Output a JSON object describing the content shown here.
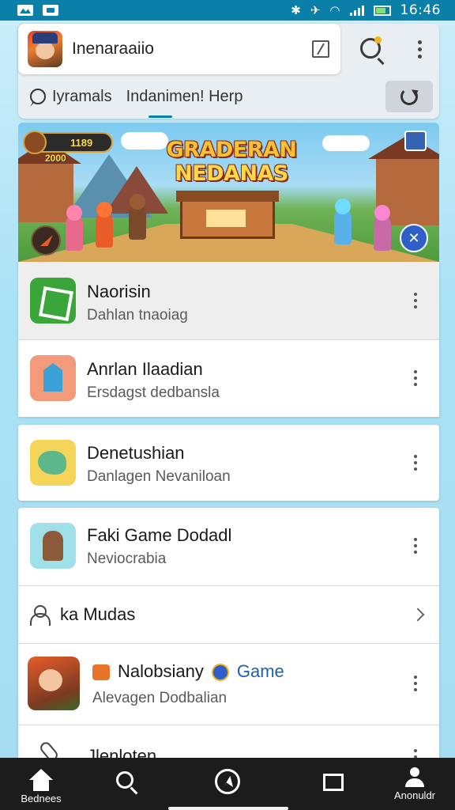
{
  "status_bar": {
    "time": "16:46"
  },
  "search": {
    "query": "Inenaraaiio"
  },
  "sub_tabs": {
    "tab1": "Iyramals",
    "tab2": "Indanimen! Herp"
  },
  "banner": {
    "title_line1": "GRADERAN",
    "title_line2": "NEDANAS",
    "hud_value": "1189",
    "hud_sub": "2000"
  },
  "list": {
    "items": [
      {
        "title": "Naorisin",
        "subtitle": "Dahlan tnaoiag",
        "icon": "app-icon-green-box",
        "color": "#3aa63a"
      },
      {
        "title": "Anrlan Ilaadian",
        "subtitle": "Ersdagst dedbansla",
        "icon": "app-icon-salmon-house",
        "color": "#f39a7b"
      },
      {
        "title": "Denetushian",
        "subtitle": "Danlagen Nevaniloan",
        "icon": "app-icon-yellow-chat",
        "color": "#f4d55a"
      },
      {
        "title": "Faki Game Dodadl",
        "subtitle": "Neviocrabia",
        "icon": "app-icon-cyan-character",
        "color": "#9fe0ea"
      }
    ],
    "section_row": {
      "label": "ka Mudas",
      "icon": "person-icon"
    },
    "featured": {
      "title": "Nalobsiany",
      "link": "Game",
      "subtitle": "Alevagen Dodbalian"
    },
    "last_item": {
      "title": "Jlenloten"
    }
  },
  "bottom_nav": {
    "home_label": "Bednees",
    "profile_label": "Anonuldr"
  },
  "colors": {
    "status_bar": "#0a7fa8",
    "nav_bg": "#1c1c1c",
    "link": "#1f5fb0"
  }
}
